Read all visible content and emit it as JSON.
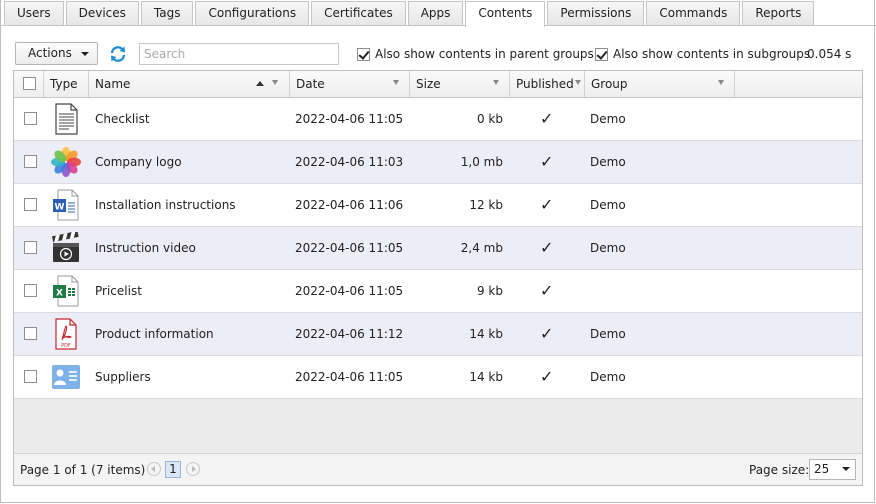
{
  "tabs": [
    "Users",
    "Devices",
    "Tags",
    "Configurations",
    "Certificates",
    "Apps",
    "Contents",
    "Permissions",
    "Commands",
    "Reports"
  ],
  "active_tab": "Contents",
  "toolbar": {
    "actions_label": "Actions",
    "search_placeholder": "Search",
    "parent_groups_label": "Also show contents in parent groups",
    "parent_groups_checked": true,
    "subgroups_label": "Also show contents in subgroups",
    "subgroups_checked": true,
    "timing": "0.054 s"
  },
  "columns": {
    "type": "Type",
    "name": "Name",
    "date": "Date",
    "size": "Size",
    "published": "Published",
    "group": "Group"
  },
  "rows": [
    {
      "icon": "text-document-icon",
      "name": "Checklist",
      "date": "2022-04-06 11:05",
      "size": "0 kb",
      "published": "✓",
      "group": "Demo"
    },
    {
      "icon": "photos-image-icon",
      "name": "Company logo",
      "date": "2022-04-06 11:03",
      "size": "1,0 mb",
      "published": "✓",
      "group": "Demo"
    },
    {
      "icon": "word-document-icon",
      "name": "Installation instructions",
      "date": "2022-04-06 11:06",
      "size": "12 kb",
      "published": "✓",
      "group": "Demo"
    },
    {
      "icon": "video-clapper-icon",
      "name": "Instruction video",
      "date": "2022-04-06 11:05",
      "size": "2,4 mb",
      "published": "✓",
      "group": "Demo"
    },
    {
      "icon": "excel-spreadsheet-icon",
      "name": "Pricelist",
      "date": "2022-04-06 11:05",
      "size": "9 kb",
      "published": "✓",
      "group": ""
    },
    {
      "icon": "pdf-document-icon",
      "name": "Product information",
      "date": "2022-04-06 11:12",
      "size": "14 kb",
      "published": "✓",
      "group": "Demo"
    },
    {
      "icon": "contact-card-icon",
      "name": "Suppliers",
      "date": "2022-04-06 11:05",
      "size": "14 kb",
      "published": "✓",
      "group": "Demo"
    }
  ],
  "pager": {
    "info": "Page 1 of 1 (7 items)",
    "current_page": "1",
    "page_size_label": "Page size:",
    "page_size": "25"
  }
}
